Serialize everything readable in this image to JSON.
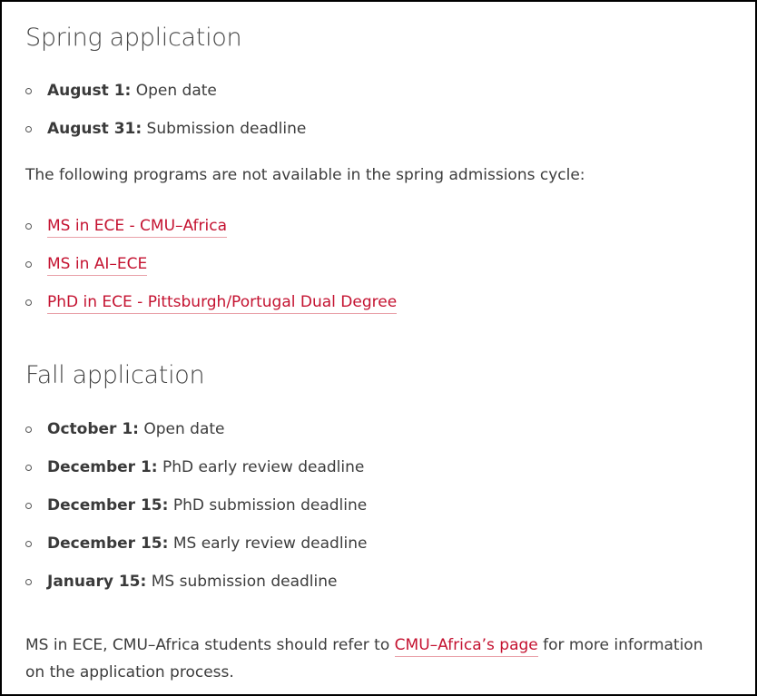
{
  "spring": {
    "heading": "Spring application",
    "dates": [
      {
        "label": "August 1:",
        "text": " Open date"
      },
      {
        "label": "August 31:",
        "text": " Submission deadline"
      }
    ],
    "note": "The following programs are not available in the spring admissions cycle:",
    "programs": [
      {
        "label": "MS in ECE - CMU–Africa"
      },
      {
        "label": "MS in AI–ECE"
      },
      {
        "label": "PhD in ECE - Pittsburgh/Portugal Dual Degree"
      }
    ]
  },
  "fall": {
    "heading": "Fall application",
    "dates": [
      {
        "label": "October 1:",
        "text": " Open date"
      },
      {
        "label": "December 1:",
        "text": " PhD early review deadline"
      },
      {
        "label": "December 15:",
        "text": " PhD submission deadline"
      },
      {
        "label": "December 15:",
        "text": " MS early review deadline"
      },
      {
        "label": "January 15:",
        "text": " MS submission deadline"
      }
    ]
  },
  "footer": {
    "before": "MS in ECE, CMU–Africa students should refer to ",
    "link": "CMU–Africa’s page",
    "after": " for more information",
    "line2": "on the application process."
  },
  "colors": {
    "link": "#c41230",
    "text": "#3c3c3c",
    "border": "#000000"
  }
}
